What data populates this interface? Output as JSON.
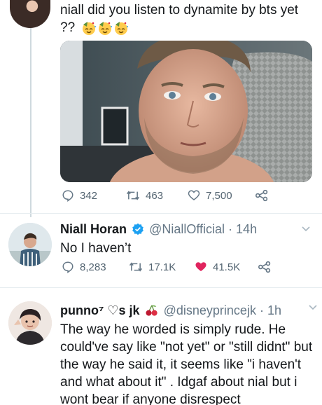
{
  "colors": {
    "like_red": "#e0245e",
    "verified_blue": "#1da1f2",
    "muted": "#657786",
    "text": "#14171a"
  },
  "tweet1": {
    "text": "niall did you listen to dynamite by bts yet ??",
    "emoji_icons": [
      "partying-face-icon",
      "partying-face-icon",
      "partying-face-icon"
    ],
    "replies": "342",
    "retweets": "463",
    "likes": "7,500"
  },
  "tweet2": {
    "name": "Niall Horan",
    "verified": true,
    "handle": "@NiallOfficial",
    "time": "· 14h",
    "text": "No I haven’t",
    "replies": "8,283",
    "retweets": "17.1K",
    "likes": "41.5K",
    "liked": true
  },
  "tweet3": {
    "name": "punno⁷ ♡s jk",
    "handle": "@disneyprincejk",
    "time": "· 1h",
    "text": "The way he worded is simply rude. He could've say like \"not yet\" or \"still didnt\" but the way he said it, it seems like \"i haven't and what about it\" . Idgaf about nial but i wont bear if anyone disrespect"
  }
}
